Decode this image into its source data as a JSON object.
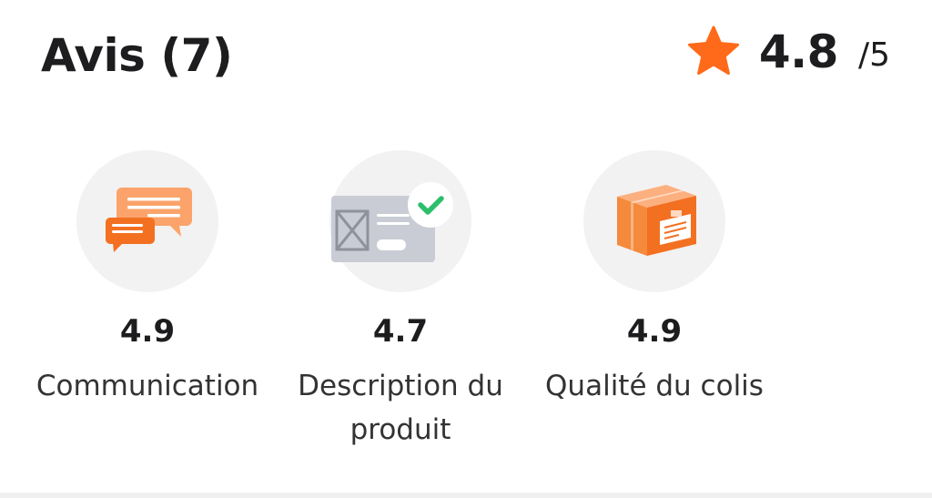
{
  "header": {
    "title": "Avis (7)",
    "rating_value": "4.8",
    "rating_max": "/5",
    "star_icon": "star-icon",
    "star_color": "#ff6a1a"
  },
  "categories": [
    {
      "score": "4.9",
      "label": "Communication",
      "icon": "chat-bubbles-icon"
    },
    {
      "score": "4.7",
      "label": "Description du produit",
      "icon": "product-description-check-icon"
    },
    {
      "score": "4.9",
      "label": "Qualité du colis",
      "icon": "package-box-icon"
    }
  ],
  "colors": {
    "accent": "#ff6a1a",
    "icon_bg": "#f2f2f2",
    "check_green": "#2dbe6c"
  }
}
